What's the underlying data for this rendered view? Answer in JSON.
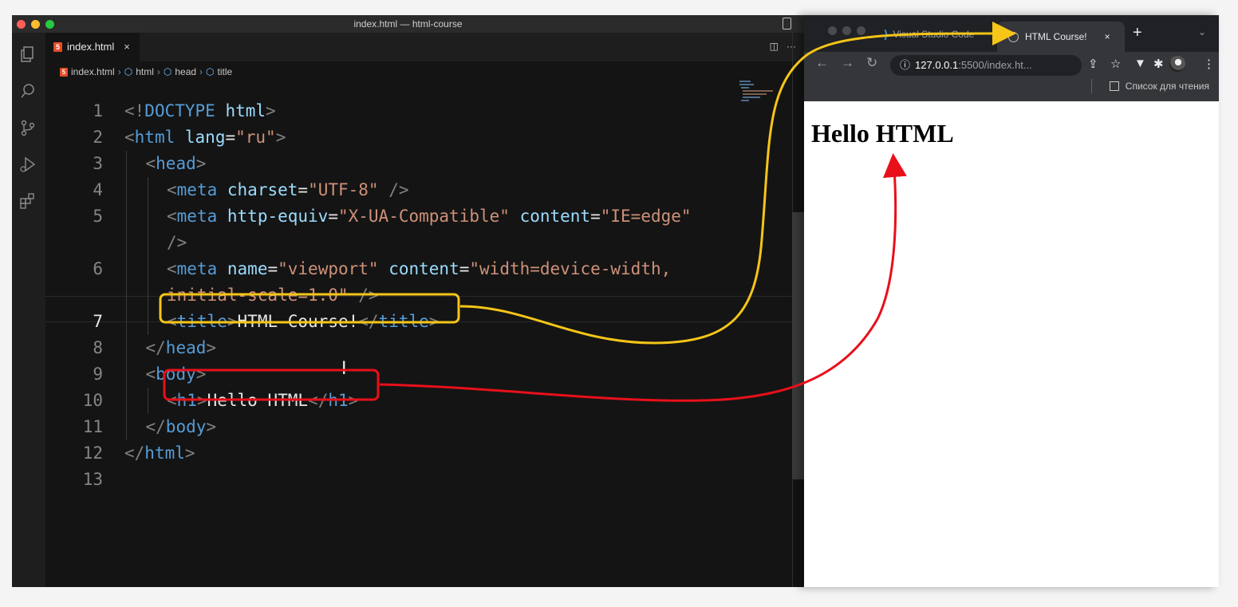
{
  "vscode": {
    "window_title": "index.html — html-course",
    "tab_label": "index.html",
    "tab_close": "×",
    "file_badge": "5",
    "tab_actions": {
      "split": "◫",
      "more": "···"
    },
    "breadcrumb": [
      "index.html",
      "html",
      "head",
      "title"
    ],
    "active_line": 7,
    "lines": [
      {
        "n": "1",
        "indent": 0,
        "tokens": [
          [
            "p",
            "<!"
          ],
          [
            "t",
            "DOCTYPE"
          ],
          [
            "w",
            " "
          ],
          [
            "a",
            "html"
          ],
          [
            "p",
            ">"
          ]
        ]
      },
      {
        "n": "2",
        "indent": 0,
        "tokens": [
          [
            "p",
            "<"
          ],
          [
            "t",
            "html"
          ],
          [
            "w",
            " "
          ],
          [
            "a",
            "lang"
          ],
          [
            "w",
            "="
          ],
          [
            "s",
            "\"ru\""
          ],
          [
            "p",
            ">"
          ]
        ]
      },
      {
        "n": "3",
        "indent": 1,
        "tokens": [
          [
            "p",
            "<"
          ],
          [
            "t",
            "head"
          ],
          [
            "p",
            ">"
          ]
        ]
      },
      {
        "n": "4",
        "indent": 2,
        "tokens": [
          [
            "p",
            "<"
          ],
          [
            "t",
            "meta"
          ],
          [
            "w",
            " "
          ],
          [
            "a",
            "charset"
          ],
          [
            "w",
            "="
          ],
          [
            "s",
            "\"UTF-8\""
          ],
          [
            "w",
            " "
          ],
          [
            "p",
            "/>"
          ]
        ]
      },
      {
        "n": "5",
        "indent": 2,
        "tokens": [
          [
            "p",
            "<"
          ],
          [
            "t",
            "meta"
          ],
          [
            "w",
            " "
          ],
          [
            "a",
            "http-equiv"
          ],
          [
            "w",
            "="
          ],
          [
            "s",
            "\"X-UA-Compatible\""
          ],
          [
            "w",
            " "
          ],
          [
            "a",
            "content"
          ],
          [
            "w",
            "="
          ],
          [
            "s",
            "\"IE=edge\""
          ]
        ]
      },
      {
        "n": "",
        "indent": 2,
        "tokens": [
          [
            "p",
            "/>"
          ]
        ]
      },
      {
        "n": "6",
        "indent": 2,
        "tokens": [
          [
            "p",
            "<"
          ],
          [
            "t",
            "meta"
          ],
          [
            "w",
            " "
          ],
          [
            "a",
            "name"
          ],
          [
            "w",
            "="
          ],
          [
            "s",
            "\"viewport\""
          ],
          [
            "w",
            " "
          ],
          [
            "a",
            "content"
          ],
          [
            "w",
            "="
          ],
          [
            "s",
            "\"width=device-width,"
          ]
        ]
      },
      {
        "n": "",
        "indent": 2,
        "tokens": [
          [
            "s",
            "initial-scale=1.0\""
          ],
          [
            "w",
            " "
          ],
          [
            "p",
            "/>"
          ]
        ]
      },
      {
        "n": "7",
        "indent": 2,
        "tokens": [
          [
            "p",
            "<"
          ],
          [
            "t",
            "title"
          ],
          [
            "p",
            ">"
          ],
          [
            "w",
            "HTML Course!"
          ],
          [
            "p",
            "</"
          ],
          [
            "t",
            "title"
          ],
          [
            "p",
            ">"
          ]
        ]
      },
      {
        "n": "8",
        "indent": 1,
        "tokens": [
          [
            "p",
            "</"
          ],
          [
            "t",
            "head"
          ],
          [
            "p",
            ">"
          ]
        ]
      },
      {
        "n": "9",
        "indent": 1,
        "tokens": [
          [
            "p",
            "<"
          ],
          [
            "t",
            "body"
          ],
          [
            "p",
            ">"
          ]
        ]
      },
      {
        "n": "10",
        "indent": 2,
        "tokens": [
          [
            "p",
            "<"
          ],
          [
            "t",
            "h1"
          ],
          [
            "p",
            ">"
          ],
          [
            "w",
            "Hello HTML"
          ],
          [
            "p",
            "</"
          ],
          [
            "t",
            "h1"
          ],
          [
            "p",
            ">"
          ]
        ]
      },
      {
        "n": "11",
        "indent": 1,
        "tokens": [
          [
            "p",
            "</"
          ],
          [
            "t",
            "body"
          ],
          [
            "p",
            ">"
          ]
        ]
      },
      {
        "n": "12",
        "indent": 0,
        "tokens": [
          [
            "p",
            "</"
          ],
          [
            "t",
            "html"
          ],
          [
            "p",
            ">"
          ]
        ]
      },
      {
        "n": "13",
        "indent": 0,
        "tokens": []
      }
    ]
  },
  "browser": {
    "inactive_tab": "Visual Studio Code",
    "active_tab": "HTML Course!",
    "tab_close": "×",
    "new_tab": "+",
    "tab_search": "⌄",
    "url_host": "127.0.0.1",
    "url_rest": ":5500/index.ht...",
    "reading_list": "Список для чтения",
    "page_heading": "Hello HTML"
  },
  "annotations": {
    "title_box_color": "#f5c518",
    "h1_box_color": "#e8101a"
  }
}
